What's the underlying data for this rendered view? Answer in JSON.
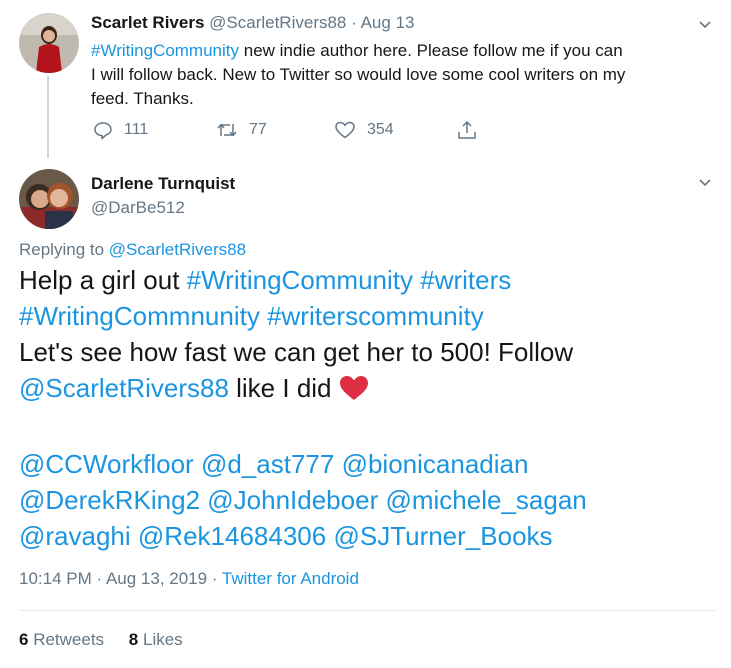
{
  "parent_tweet": {
    "author_name": "Scarlet Rivers",
    "handle": "@ScarletRivers88",
    "sep": "·",
    "date": "Aug 13",
    "hashtag": "#WritingCommunity",
    "text_line1": " new indie author here. Please follow me if you can",
    "text_line2": "I will follow back. New to Twitter so would love some cool writers on my",
    "text_line3": "feed. Thanks.",
    "replies": "111",
    "retweets": "77",
    "likes": "354"
  },
  "main_tweet": {
    "author_name": "Darlene Turnquist",
    "handle": "@DarBe512",
    "replying_to_label": "Replying to ",
    "replying_to_handle": "@ScarletRivers88",
    "line1_text": "Help a girl out ",
    "line1_tag1": "#WritingCommunity",
    "line1_tag2": "#writers",
    "line2_tag1": "#WritingCommnunity",
    "line2_tag2": "#writerscommunity",
    "line3_text": "Let's see how fast we can get her to 500!  Follow",
    "line4_mention": "@ScarletRivers88",
    "line4_text": " like I did ",
    "mentions_line1": [
      "@CCWorkfloor",
      "@d_ast777",
      "@bionicanadian"
    ],
    "mentions_line2": [
      "@DerekRKing2",
      "@JohnIdeboer",
      "@michele_sagan"
    ],
    "mentions_line3": [
      "@ravaghi",
      "@Rek14684306",
      "@SJTurner_Books"
    ],
    "time": "10:14 PM",
    "dot": " · ",
    "date": "Aug 13, 2019",
    "source": "Twitter for Android",
    "retweet_count": "6",
    "retweet_label": " Retweets",
    "like_count": "8",
    "like_label": " Likes"
  },
  "colors": {
    "link": "#1b95e0",
    "muted": "#657786",
    "heart": "#e0245e",
    "border": "#e6ecf0"
  },
  "icons": [
    "chevron-down-icon",
    "reply-icon",
    "retweet-icon",
    "like-icon",
    "share-icon",
    "heart-emoji"
  ]
}
